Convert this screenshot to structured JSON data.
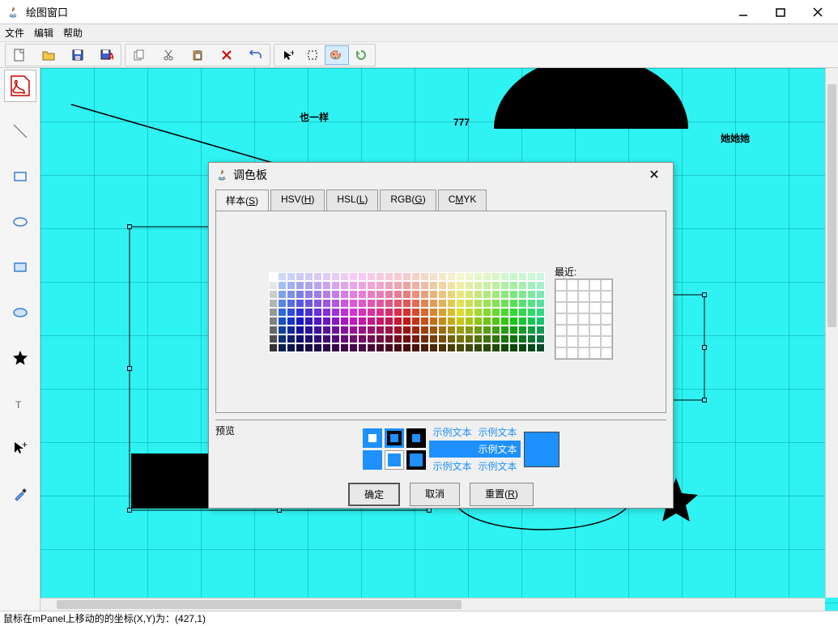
{
  "window": {
    "title": "绘图窗口"
  },
  "menu": {
    "file": "文件",
    "edit": "编辑",
    "help": "帮助"
  },
  "toolbar_icons": {
    "new": "new",
    "open": "open",
    "save": "save",
    "saveas": "saveas",
    "copy": "copy",
    "cut": "cut",
    "paste": "paste",
    "delete": "delete",
    "undo": "undo",
    "pointer": "pointer",
    "marquee": "marquee",
    "palette": "palette",
    "refresh": "refresh"
  },
  "canvas": {
    "texts": [
      {
        "label": "也一样"
      },
      {
        "label": "777"
      },
      {
        "label": "她她她"
      }
    ]
  },
  "dialog": {
    "title": "调色板",
    "tabs": {
      "swatches": "样本(S)",
      "hsv": "HSV(H)",
      "hsl": "HSL(L)",
      "rgb": "RGB(G)",
      "cmyk": "CMYK"
    },
    "recent_label": "最近:",
    "preview_label": "预览",
    "sample_text": "示例文本",
    "ok": "确定",
    "cancel": "取消",
    "reset": "重置(R)"
  },
  "status": {
    "text": "鼠标在mPanel上移动的的坐标(X,Y)为：(427,1)"
  }
}
